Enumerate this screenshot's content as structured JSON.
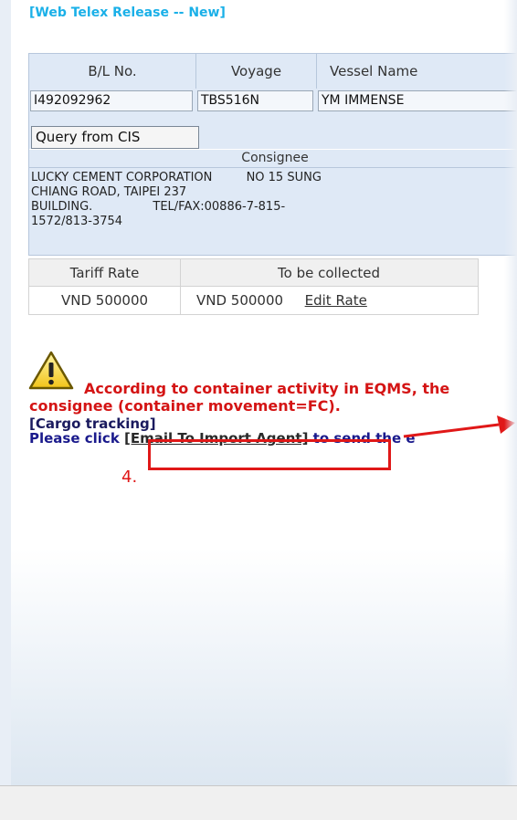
{
  "title": "[Web Telex Release -- New]",
  "bl_table": {
    "headers": [
      "B/L No.",
      "Voyage",
      "Vessel Name"
    ],
    "bl_no": "I492092962",
    "voyage": "TBS516N",
    "vessel_name": "YM IMMENSE"
  },
  "query_button": "Query from CIS",
  "consignee": {
    "label": "Consignee",
    "text": "LUCKY CEMENT CORPORATION         NO 15 SUNG\nCHIANG ROAD, TAIPEI 237\nBUILDING.                TEL/FAX:00886-7-815-\n1572/813-3754"
  },
  "tariff": {
    "headers": [
      "Tariff Rate",
      "To be collected"
    ],
    "tariff_rate": "VND 500000",
    "to_be_collected": "VND 500000",
    "edit_link": "Edit Rate"
  },
  "warning": {
    "icon": "warning-triangle-icon",
    "line1": "According to container activity in EQMS, the",
    "line2": "consignee (container movement=FC).",
    "cargo_link": "[Cargo tracking]",
    "please_prefix": "Please click ",
    "email_link": "[Email To Import Agent]",
    "please_suffix": " to send the e"
  },
  "annotation": {
    "step": "4."
  },
  "colors": {
    "title": "#1ab0e8",
    "warning": "#d41414",
    "annotation": "#e01818",
    "panel": "#dfe9f6"
  }
}
